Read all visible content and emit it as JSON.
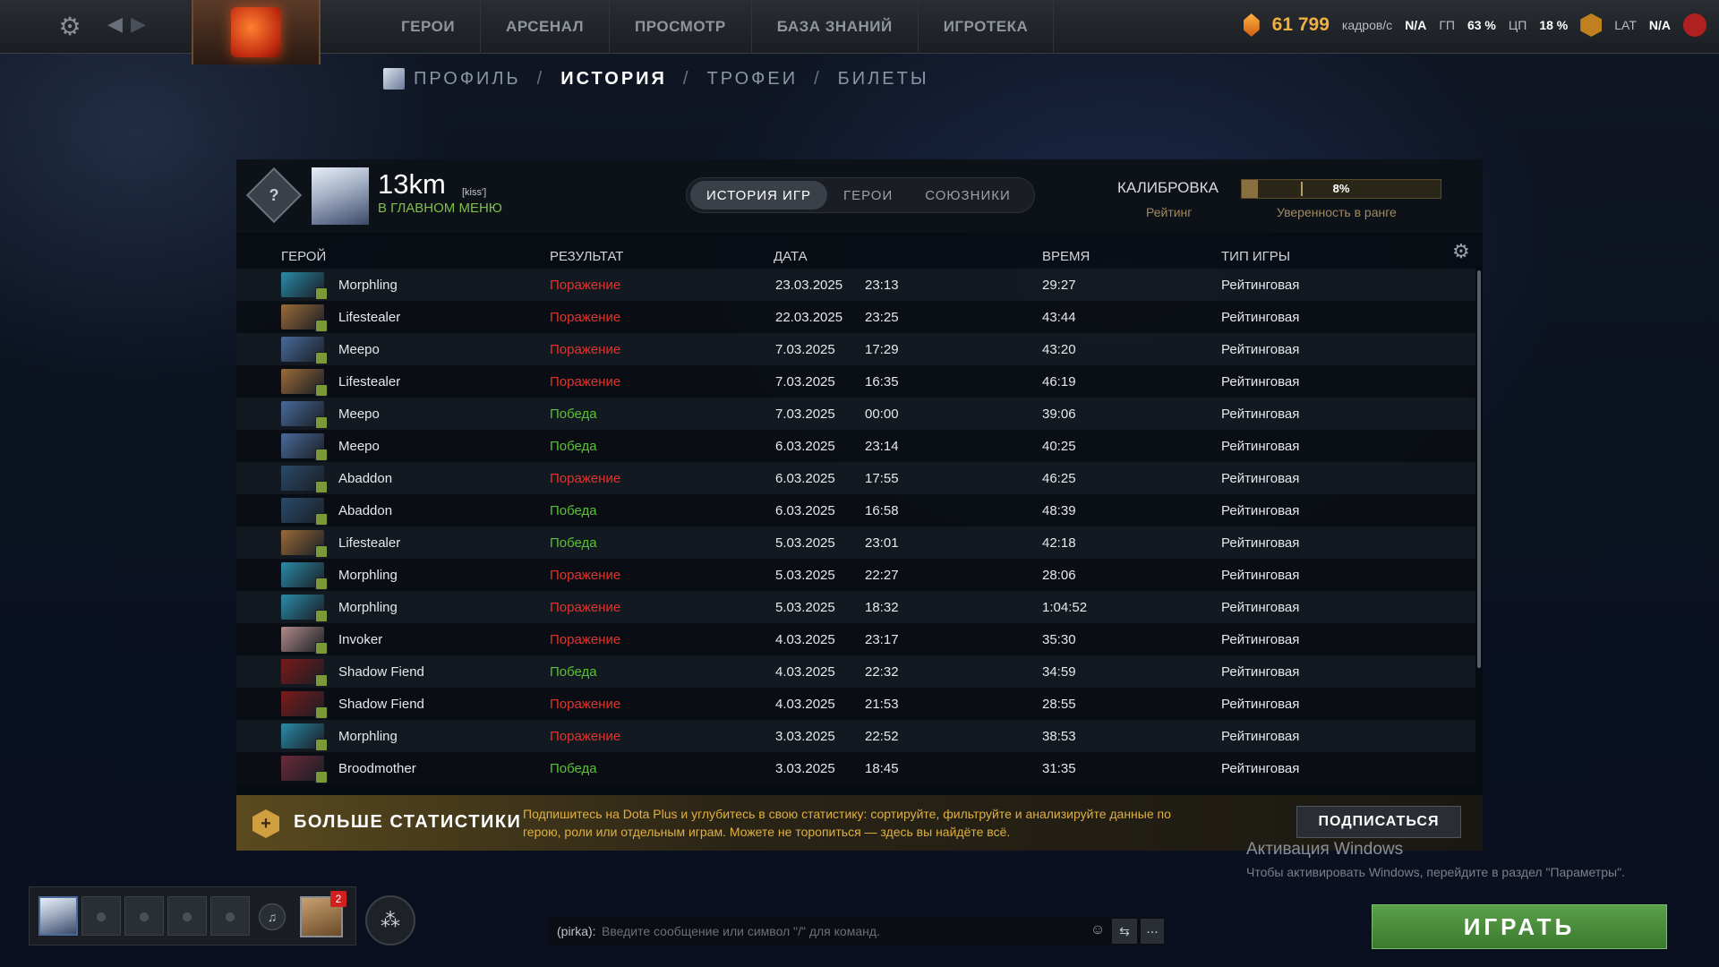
{
  "topbar": {
    "nav": [
      "ГЕРОИ",
      "АРСЕНАЛ",
      "ПРОСМОТР",
      "БАЗА ЗНАНИЙ",
      "ИГРОТЕКА"
    ],
    "shards": "61 799",
    "fps_label": "кадров/с",
    "fps_value": "N/A",
    "gpu_label": "ГП",
    "gpu_value": "63 %",
    "cpu_label": "ЦП",
    "cpu_value": "18 %",
    "lat_label": "LAT",
    "lat_value": "N/A"
  },
  "subnav": {
    "profile": "ПРОФИЛЬ",
    "history": "ИСТОРИЯ",
    "trophies": "ТРОФЕИ",
    "tickets": "БИЛЕТЫ",
    "separator": "/"
  },
  "profile": {
    "rank_symbol": "?",
    "name": "13km",
    "tag": "[kiss']",
    "status": "В ГЛАВНОМ МЕНЮ",
    "tabs": [
      "ИСТОРИЯ ИГР",
      "ГЕРОИ",
      "СОЮЗНИКИ"
    ],
    "calibration_label": "КАЛИБРОВКА",
    "rating_label": "Рейтинг",
    "confidence_value": "8%",
    "confidence_fraction": 0.08,
    "confidence_label": "Уверенность в ранге"
  },
  "table": {
    "headers": {
      "hero": "ГЕРОЙ",
      "result": "РЕЗУЛЬТАТ",
      "date": "ДАТА",
      "duration": "ВРЕМЯ",
      "type": "ТИП ИГРЫ"
    },
    "rows": [
      {
        "hero": "Morphling",
        "result": "Поражение",
        "win": false,
        "date": "23.03.2025",
        "time": "23:13",
        "duration": "29:27",
        "type": "Рейтинговая"
      },
      {
        "hero": "Lifestealer",
        "result": "Поражение",
        "win": false,
        "date": "22.03.2025",
        "time": "23:25",
        "duration": "43:44",
        "type": "Рейтинговая"
      },
      {
        "hero": "Meepo",
        "result": "Поражение",
        "win": false,
        "date": "7.03.2025",
        "time": "17:29",
        "duration": "43:20",
        "type": "Рейтинговая"
      },
      {
        "hero": "Lifestealer",
        "result": "Поражение",
        "win": false,
        "date": "7.03.2025",
        "time": "16:35",
        "duration": "46:19",
        "type": "Рейтинговая"
      },
      {
        "hero": "Meepo",
        "result": "Победа",
        "win": true,
        "date": "7.03.2025",
        "time": "00:00",
        "duration": "39:06",
        "type": "Рейтинговая"
      },
      {
        "hero": "Meepo",
        "result": "Победа",
        "win": true,
        "date": "6.03.2025",
        "time": "23:14",
        "duration": "40:25",
        "type": "Рейтинговая"
      },
      {
        "hero": "Abaddon",
        "result": "Поражение",
        "win": false,
        "date": "6.03.2025",
        "time": "17:55",
        "duration": "46:25",
        "type": "Рейтинговая"
      },
      {
        "hero": "Abaddon",
        "result": "Победа",
        "win": true,
        "date": "6.03.2025",
        "time": "16:58",
        "duration": "48:39",
        "type": "Рейтинговая"
      },
      {
        "hero": "Lifestealer",
        "result": "Победа",
        "win": true,
        "date": "5.03.2025",
        "time": "23:01",
        "duration": "42:18",
        "type": "Рейтинговая"
      },
      {
        "hero": "Morphling",
        "result": "Поражение",
        "win": false,
        "date": "5.03.2025",
        "time": "22:27",
        "duration": "28:06",
        "type": "Рейтинговая"
      },
      {
        "hero": "Morphling",
        "result": "Поражение",
        "win": false,
        "date": "5.03.2025",
        "time": "18:32",
        "duration": "1:04:52",
        "type": "Рейтинговая"
      },
      {
        "hero": "Invoker",
        "result": "Поражение",
        "win": false,
        "date": "4.03.2025",
        "time": "23:17",
        "duration": "35:30",
        "type": "Рейтинговая"
      },
      {
        "hero": "Shadow Fiend",
        "result": "Победа",
        "win": true,
        "date": "4.03.2025",
        "time": "22:32",
        "duration": "34:59",
        "type": "Рейтинговая"
      },
      {
        "hero": "Shadow Fiend",
        "result": "Поражение",
        "win": false,
        "date": "4.03.2025",
        "time": "21:53",
        "duration": "28:55",
        "type": "Рейтинговая"
      },
      {
        "hero": "Morphling",
        "result": "Поражение",
        "win": false,
        "date": "3.03.2025",
        "time": "22:52",
        "duration": "38:53",
        "type": "Рейтинговая"
      },
      {
        "hero": "Broodmother",
        "result": "Победа",
        "win": true,
        "date": "3.03.2025",
        "time": "18:45",
        "duration": "31:35",
        "type": "Рейтинговая"
      }
    ]
  },
  "hero_colors": {
    "Morphling": "#2a8aa8",
    "Lifestealer": "#9a6a3a",
    "Meepo": "#4a6a9a",
    "Abaddon": "#2a4a6a",
    "Invoker": "#b08a8a",
    "Shadow Fiend": "#7a1a1a",
    "Broodmother": "#6a2a3a"
  },
  "colors": {
    "loss": "#e0342c",
    "win": "#5cbf3a",
    "play": "#4a8c3c",
    "plus": "#e0b040"
  },
  "plus": {
    "title": "БОЛЬШЕ СТАТИСТИКИ",
    "description": "Подпишитесь на Dota Plus и углубитесь в свою статистику: сортируйте, фильтруйте и анализируйте данные по герою, роли или отдельным играм. Можете не торопиться — здесь вы найдёте всё.",
    "button": "ПОДПИСАТЬСЯ"
  },
  "windows": {
    "activation_title": "Активация Windows",
    "activation_text": "Чтобы активировать Windows, перейдите в раздел \"Параметры\"."
  },
  "chat": {
    "channel": "(pirka):",
    "placeholder": "Введите сообщение или символ \"/\" для команд.",
    "more": "..."
  },
  "party": {
    "notification_count": "2"
  },
  "play_button": "ИГРАТЬ"
}
